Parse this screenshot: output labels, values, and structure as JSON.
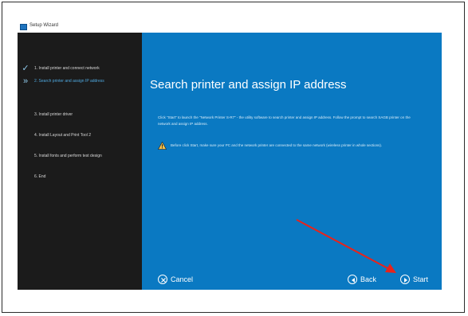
{
  "window": {
    "title": "Setup Wizard"
  },
  "sidebar": {
    "items": [
      {
        "label": "1. Install printer and connect network",
        "state": "done"
      },
      {
        "label": "2. Search printer and assign IP address",
        "state": "current"
      },
      {
        "label": "3. Install printer driver",
        "state": "pending"
      },
      {
        "label": "4. Install Layout and Print Tool 2",
        "state": "pending"
      },
      {
        "label": "5. Install fonts and perform test design",
        "state": "pending"
      },
      {
        "label": "6. End",
        "state": "pending"
      }
    ]
  },
  "main": {
    "heading": "Search printer and assign IP address",
    "description": "Click \"Start\" to launch the \"Network Printer S-R7\" - the utility software to search printer and assign IP address. Follow the prompt to search SAGB printer on the network and assign IP address.",
    "warning": "Before click Start, make sure your PC and the network printer are connected to the same network (wireless printer in whole sections)."
  },
  "footer": {
    "cancel_label": "Cancel",
    "back_label": "Back",
    "start_label": "Start"
  },
  "colors": {
    "content_bg": "#0a79c2",
    "sidebar_bg": "#1b1b1b",
    "active_step": "#4fa9e0",
    "annotation_arrow": "#e8231b"
  }
}
